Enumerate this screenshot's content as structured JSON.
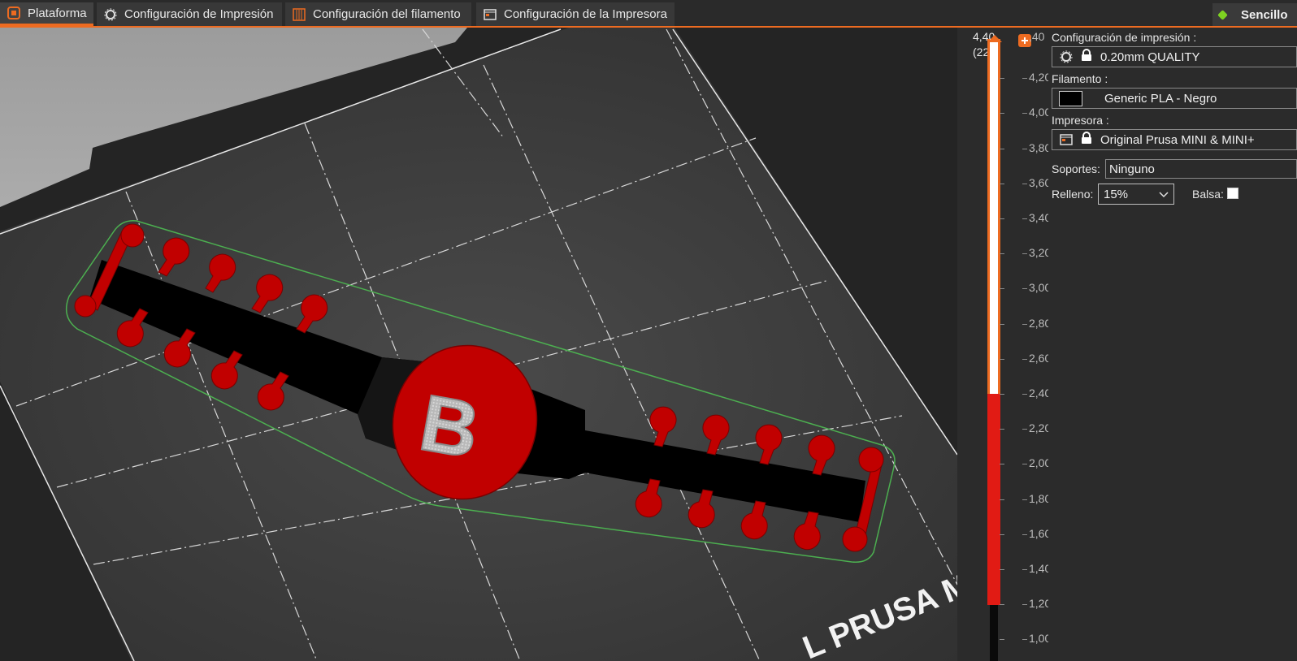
{
  "tabs": [
    {
      "label": "Plataforma",
      "icon": "plater-icon",
      "active": true
    },
    {
      "label": "Configuración de Impresión",
      "icon": "gear-icon",
      "active": false
    },
    {
      "label": "Configuración del filamento",
      "icon": "spool-icon",
      "active": false
    },
    {
      "label": "Configuración de la Impresora",
      "icon": "printer-icon",
      "active": false
    }
  ],
  "mode": {
    "label": "Sencillo",
    "color": "#7ed321"
  },
  "viewport": {
    "bed_text": "L PRUSA M",
    "object_letter": "B",
    "colors": {
      "model_red": "#c10000",
      "bed_dark": "#3a3a3a",
      "selection_outline": "#4caf50"
    }
  },
  "layer_slider": {
    "top_value": "4,40",
    "top_layer": "(22)",
    "ticks": [
      "4,40",
      "4,20",
      "4,00",
      "3,80",
      "3,60",
      "3,40",
      "3,20",
      "3,00",
      "2,80",
      "2,60",
      "2,40",
      "2,20",
      "2,00",
      "1,80",
      "1,60",
      "1,40",
      "1,20",
      "1,00"
    ],
    "colors": {
      "accent": "#ed6b21",
      "red": "#e11b14"
    }
  },
  "sidebar": {
    "print_settings_label": "Configuración de impresión :",
    "print_profile": "0.20mm QUALITY",
    "filament_label": "Filamento :",
    "filament_profile": "Generic PLA - Negro",
    "printer_label": "Impresora :",
    "printer_profile": "Original Prusa MINI & MINI+",
    "supports_label": "Soportes:",
    "supports_value": "Ninguno",
    "infill_label": "Relleno:",
    "infill_value": "15%",
    "brim_label": "Balsa:",
    "brim_checked": false
  }
}
